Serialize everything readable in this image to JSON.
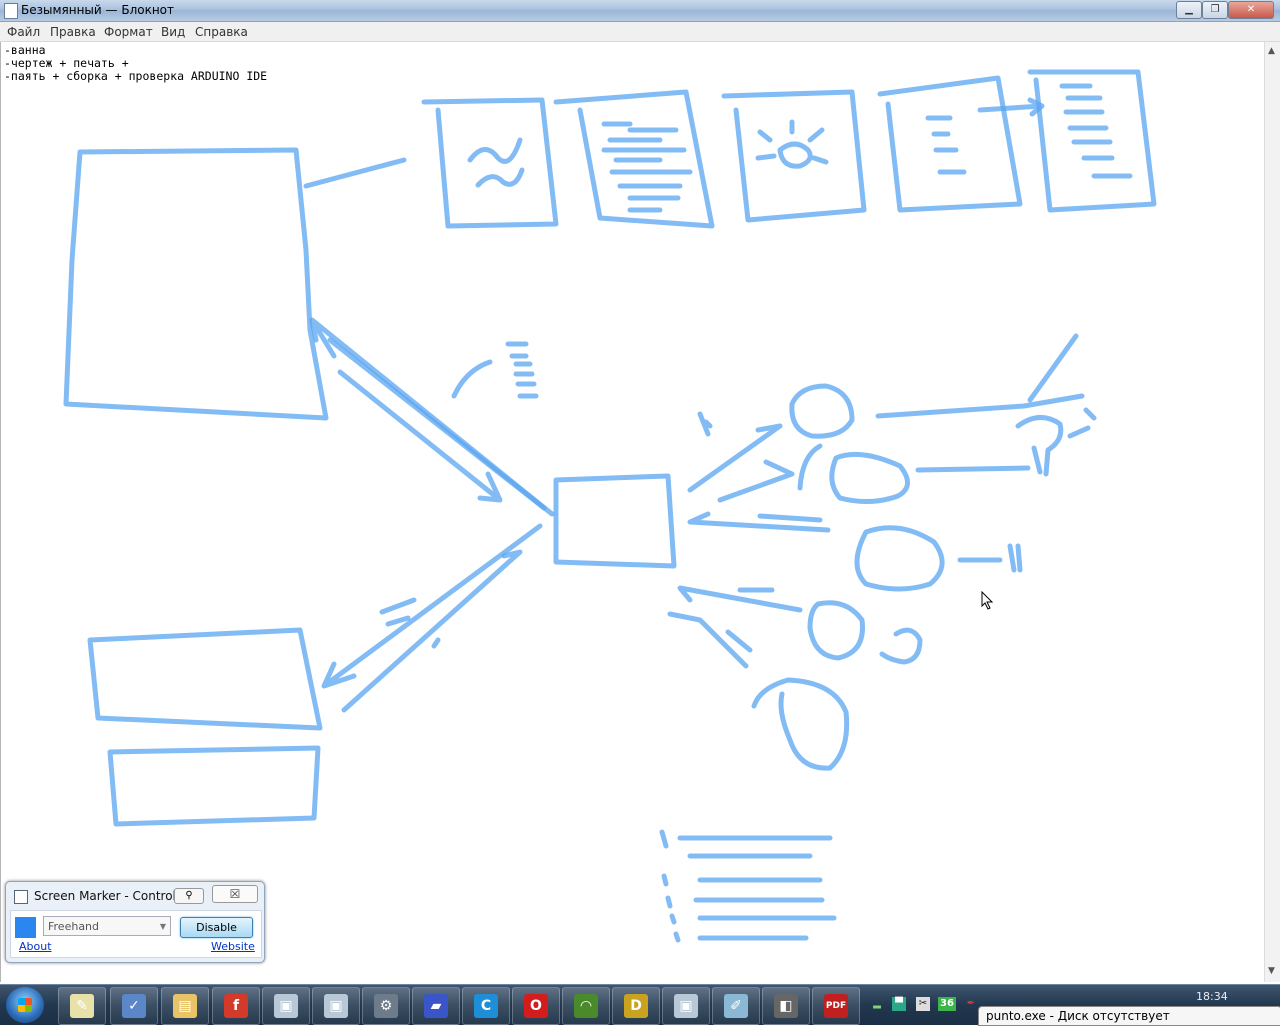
{
  "window": {
    "title": "Безымянный — Блокнот",
    "minimize_glyph": "▁",
    "maximize_glyph": "❐",
    "close_glyph": "✕"
  },
  "menu": {
    "items": [
      "Файл",
      "Правка",
      "Формат",
      "Вид",
      "Справка"
    ]
  },
  "editor": {
    "lines": [
      "-ванна",
      "-чертеж + печать +",
      "-паять + сборка + проверка ARDUINO IDE"
    ]
  },
  "screen_marker": {
    "title": "Screen Marker - Controls",
    "pin_glyph": "⚲",
    "close_glyph": "☒",
    "color": "#2b86f0",
    "tool_value": "Freehand",
    "disable_label": "Disable",
    "about_label": "About",
    "website_label": "Website"
  },
  "taskbar": {
    "apps": [
      {
        "name": "notepad",
        "glyph": "✎",
        "color": "#e9e2a8"
      },
      {
        "name": "paint-task",
        "glyph": "✓",
        "color": "#5b86c8"
      },
      {
        "name": "explorer",
        "glyph": "▤",
        "color": "#e8c368"
      },
      {
        "name": "flash",
        "glyph": "f",
        "color": "#d33a2a"
      },
      {
        "name": "window-a",
        "glyph": "▣",
        "color": "#b9c8d6"
      },
      {
        "name": "window-b",
        "glyph": "▣",
        "color": "#b9c8d6"
      },
      {
        "name": "tool",
        "glyph": "⚙",
        "color": "#6d7b8a"
      },
      {
        "name": "floppy",
        "glyph": "▰",
        "color": "#3a55c8"
      },
      {
        "name": "ccleaner",
        "glyph": "C",
        "color": "#1e8fd6"
      },
      {
        "name": "opera",
        "glyph": "O",
        "color": "#d31d1d"
      },
      {
        "name": "wifi",
        "glyph": "◠",
        "color": "#4a8a2a"
      },
      {
        "name": "d64",
        "glyph": "D",
        "color": "#c9a21f"
      },
      {
        "name": "window-c",
        "glyph": "▣",
        "color": "#b9c8d6"
      },
      {
        "name": "pen",
        "glyph": "✐",
        "color": "#8bb8d4"
      },
      {
        "name": "cameo",
        "glyph": "◧",
        "color": "#666666"
      },
      {
        "name": "pdf",
        "glyph": "PDF",
        "color": "#c02020"
      }
    ],
    "tray_number": "36",
    "clock": "18:34",
    "balloon_text": "punto.exe - Диск отсутствует"
  }
}
